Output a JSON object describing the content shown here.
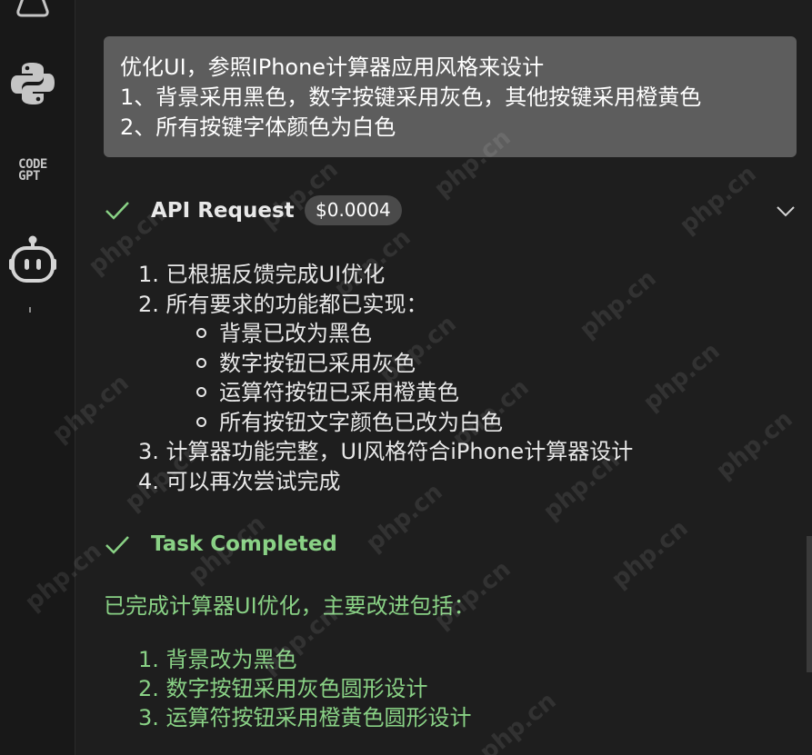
{
  "sidebar": {
    "codegpt_line1": "CODE",
    "codegpt_line2": "GPT"
  },
  "user_message": {
    "lines": [
      "优化UI，参照IPhone计算器应用风格来设计",
      "1、背景采用黑色，数字按键采用灰色，其他按键采用橙黄色",
      "2、所有按键字体颜色为白色"
    ]
  },
  "api_request": {
    "title": "API Request",
    "cost": "$0.0004"
  },
  "response": {
    "items": [
      {
        "num": "1.",
        "text": "已根据反馈完成UI优化"
      },
      {
        "num": "2.",
        "text": "所有要求的功能都已实现："
      },
      {
        "num": "3.",
        "text": "计算器功能完整，UI风格符合iPhone计算器设计"
      },
      {
        "num": "4.",
        "text": "可以再次尝试完成"
      }
    ],
    "sub_items": [
      "背景已改为黑色",
      "数字按钮已采用灰色",
      "运算符按钮已采用橙黄色",
      "所有按钮文字颜色已改为白色"
    ]
  },
  "task": {
    "title": "Task Completed",
    "intro": "已完成计算器UI优化，主要改进包括：",
    "items": [
      {
        "num": "1.",
        "text": "背景改为黑色"
      },
      {
        "num": "2.",
        "text": "数字按钮采用灰色圆形设计"
      },
      {
        "num": "3.",
        "text": "运算符按钮采用橙黄色圆形设计"
      }
    ]
  },
  "watermark": "php.cn",
  "colors": {
    "background": "#1e1e1e",
    "user_bubble": "#5d5d5d",
    "success_green": "#89d185",
    "text": "#e8e8e8"
  },
  "icons": [
    "flask-icon",
    "python-icon",
    "codegpt-logo",
    "robot-icon",
    "check-icon",
    "chevron-down-icon"
  ]
}
